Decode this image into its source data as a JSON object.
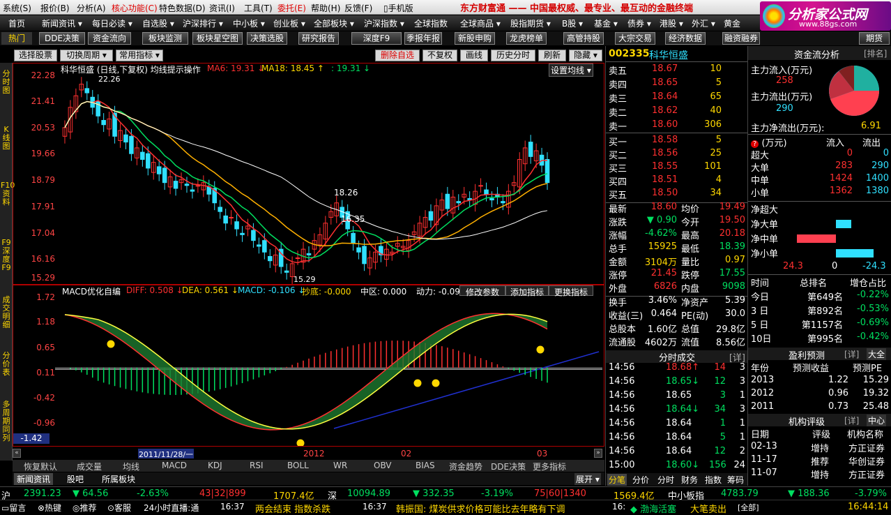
{
  "menubar": {
    "items": [
      "系统(S)",
      "报价(B)",
      "分析(A)",
      "核心功能(C)",
      "特色数据(D)",
      "资讯(I)",
      "工具(T)",
      "委托(E)",
      "帮助(H)",
      "反馈(F)",
      "▯手机版"
    ],
    "banner": "东方财富通 —— 中国最权威、最专业、最互动的金融终端"
  },
  "logo": {
    "title": "分析家公式网",
    "url": "www.88gs.com"
  },
  "nav1": [
    "首页",
    "新闻资讯 ▾",
    "每日必读 ▾",
    "自选股 ▾",
    "沪深排行 ▾",
    "中小板 ▾",
    "创业板 ▾",
    "全部板块 ▾",
    "沪深指数 ▾",
    "全球指数",
    "全球商品 ▾",
    "股指期货 ▾",
    "B股 ▾",
    "基金 ▾",
    "债券 ▾",
    "港股 ▾",
    "外汇 ▾",
    "黄金"
  ],
  "nav2": [
    "热门",
    "DDE决策",
    "资金流向",
    "板块监测",
    "板块星空图",
    "决策选股",
    "研究报告",
    "深度F9",
    "季报年报",
    "新股申购",
    "龙虎榜单",
    "高管持股",
    "大宗交易",
    "经济数据",
    "融资融券",
    "期货"
  ],
  "toolbar": {
    "left": [
      "选择股票",
      "切换周期 ▾",
      "常用指标 ▾"
    ],
    "right": [
      "删除自选",
      "不复权",
      "画线",
      "历史分时",
      "刷新",
      "隐藏 ▾"
    ]
  },
  "sidebar": [
    "分时图",
    "K线图",
    "F10资料",
    "F9深度F9",
    "成交明细",
    "分价表",
    "多周期同列"
  ],
  "kchart": {
    "title": "科华恒盛 (日线,下复权) 均线提示操作",
    "ma6": "MA6: 19.31 ↓",
    "ma18": "MA18: 18.45 ↑",
    "ma_extra": ": 19.31 ↓",
    "setting": "设置均线 ▾",
    "prices": [
      "22.28",
      "21.41",
      "20.53",
      "19.66",
      "18.79",
      "17.91",
      "17.04",
      "16.16",
      "15.29"
    ],
    "hi_label": "22.26",
    "lo_label": "15.29",
    "mid1": "18.26",
    "mid2": "16.35"
  },
  "macd": {
    "title": "MACD优化自编",
    "diff": "DIFF: 0.508 ↓",
    "dea": "DEA: 0.561 ↓",
    "macd": "MACD: -0.106 ↓",
    "chaodi": "抄底: -0.000",
    "zhongqu": "中区: 0.000",
    "dongli": "动力: -0.09",
    "btns": [
      "修改参数",
      "添加指标",
      "更换指标"
    ],
    "levels": [
      "1.72",
      "1.18",
      "0.65",
      "0.11",
      "-0.42",
      "-0.96",
      "-1.42"
    ]
  },
  "xaxis": {
    "date": "2011/11/28/一",
    "labels": [
      "2012",
      "02",
      "03"
    ]
  },
  "indtabs": [
    "恢复默认",
    "成交量",
    "均线",
    "MACD",
    "KDJ",
    "RSI",
    "BOLL",
    "WR",
    "OBV",
    "BIAS",
    "资金趋势",
    "DDE决策",
    "更多指标"
  ],
  "bottomtabs": [
    "新闻资讯",
    "股吧",
    "所属板块"
  ],
  "expand": "展开 ▾",
  "stock": {
    "code": "002335",
    "name": "科华恒盛"
  },
  "orderbook": {
    "sell": [
      [
        "卖五",
        "18.67",
        "10"
      ],
      [
        "卖四",
        "18.65",
        "5"
      ],
      [
        "卖三",
        "18.64",
        "65"
      ],
      [
        "卖二",
        "18.62",
        "40"
      ],
      [
        "卖一",
        "18.60",
        "306"
      ]
    ],
    "buy": [
      [
        "买一",
        "18.58",
        "5"
      ],
      [
        "买二",
        "18.56",
        "25"
      ],
      [
        "买三",
        "18.55",
        "101"
      ],
      [
        "买四",
        "18.51",
        "4"
      ],
      [
        "买五",
        "18.50",
        "34"
      ]
    ]
  },
  "stats": [
    [
      "最新",
      "18.60",
      "均价",
      "19.49"
    ],
    [
      "涨跌",
      "▼ 0.90",
      "今开",
      "19.50"
    ],
    [
      "涨幅",
      "-4.62%",
      "最高",
      "20.18"
    ],
    [
      "总手",
      "15925",
      "最低",
      "18.39"
    ],
    [
      "金额",
      "3104万",
      "量比",
      "0.97"
    ],
    [
      "涨停",
      "21.45",
      "跌停",
      "17.55"
    ],
    [
      "外盘",
      "6826",
      "内盘",
      "9098"
    ]
  ],
  "stats2": [
    [
      "换手",
      "3.46%",
      "净资产",
      "5.39"
    ],
    [
      "收益(三)",
      "0.464",
      "PE(动)",
      "30.0"
    ],
    [
      "总股本",
      "1.60亿",
      "总值",
      "29.8亿"
    ],
    [
      "流通股",
      "4602万",
      "流值",
      "8.56亿"
    ]
  ],
  "ticks": {
    "title": "分时成交",
    "more": "[详]",
    "rows": [
      [
        "14:56",
        "18.68↑",
        "14",
        "3"
      ],
      [
        "14:56",
        "18.65↓",
        "12",
        "3"
      ],
      [
        "14:56",
        "18.65",
        "3",
        "1"
      ],
      [
        "14:56",
        "18.64↓",
        "34",
        "3"
      ],
      [
        "14:56",
        "18.64",
        "1",
        "1"
      ],
      [
        "14:56",
        "18.64",
        "5",
        "1"
      ],
      [
        "14:56",
        "18.64",
        "12",
        "2"
      ],
      [
        "15:00",
        "18.60↓",
        "156",
        "24"
      ]
    ]
  },
  "quotetabs": [
    "分笔",
    "分价",
    "分时",
    "财务",
    "指数",
    "筹码"
  ],
  "fund": {
    "title": "资金流分析",
    "rank": "[排名]",
    "in_label": "主力流入(万元)",
    "in_val": "258",
    "out_label": "主力流出(万元)",
    "out_val": "290",
    "net_label": "主力净流出(万元):",
    "net_val": "6.91",
    "hdr": [
      "(万元)",
      "流入",
      "流出"
    ],
    "rows": [
      [
        "超大",
        "0",
        "0"
      ],
      [
        "大单",
        "283",
        "290"
      ],
      [
        "中单",
        "1424",
        "1400"
      ],
      [
        "小单",
        "1362",
        "1380"
      ]
    ],
    "bars": [
      "净超大",
      "净大单",
      "净中单",
      "净小单"
    ],
    "axis": [
      "24.3",
      "0",
      "-24.3"
    ],
    "rank_hdr": [
      "时间",
      "总排名",
      "增仓占比"
    ],
    "rank_rows": [
      [
        "今日",
        "第649名",
        "-0.22%"
      ],
      [
        "3 日",
        "第892名",
        "-0.53%"
      ],
      [
        "5 日",
        "第1157名",
        "-0.69%"
      ],
      [
        "10日",
        "第995名",
        "-0.42%"
      ]
    ],
    "profit_title": "盈利预测",
    "profit_more": "[详]",
    "profit_btn": "大全",
    "profit_hdr": [
      "年份",
      "预测收益",
      "预测PE"
    ],
    "profit_rows": [
      [
        "2013",
        "1.22",
        "15.29"
      ],
      [
        "2012",
        "0.96",
        "19.32"
      ],
      [
        "2011",
        "0.73",
        "25.48"
      ]
    ],
    "rating_title": "机构评级",
    "rating_more": "[详]",
    "rating_btn": "中心",
    "rating_hdr": [
      "日期",
      "评级",
      "机构名称"
    ],
    "rating_rows": [
      [
        "02-13",
        "增持",
        "方正证券"
      ],
      [
        "11-17",
        "推荐",
        "华创证券"
      ],
      [
        "11-07",
        "增持",
        "方正证券"
      ]
    ]
  },
  "status1": {
    "sh": "沪",
    "sh_idx": "2391.23",
    "sh_chg": "▼ 64.56",
    "sh_pct": "-2.63%",
    "sh_cnt": "43|32|899",
    "sh_amt": "1707.4亿",
    "sz": "深",
    "sz_idx": "10094.89",
    "sz_chg": "▼ 332.35",
    "sz_pct": "-3.19%",
    "sz_cnt": "75|60|1340",
    "sz_amt": "1569.4亿",
    "zx": "中小板指",
    "zx_idx": "4783.79",
    "zx_chg": "▼ 188.36",
    "zx_pct": "-3.79%"
  },
  "status2": {
    "items": [
      "▭留言",
      "⊗热键",
      "◎推荐",
      "⊙客服",
      "24小时直播:通",
      "16:37",
      "两会结束 指数杀跌",
      "16:37",
      "韩振国: 煤炭供求价格可能比去年略有下调",
      "16:",
      "◆ 渤海活塞",
      "大笔卖出",
      "[全部]",
      "16:44:14"
    ]
  },
  "colors": {
    "up": "#ff3030",
    "down": "#00e060",
    "accent": "#ffd800",
    "cyan": "#30e0ff"
  }
}
